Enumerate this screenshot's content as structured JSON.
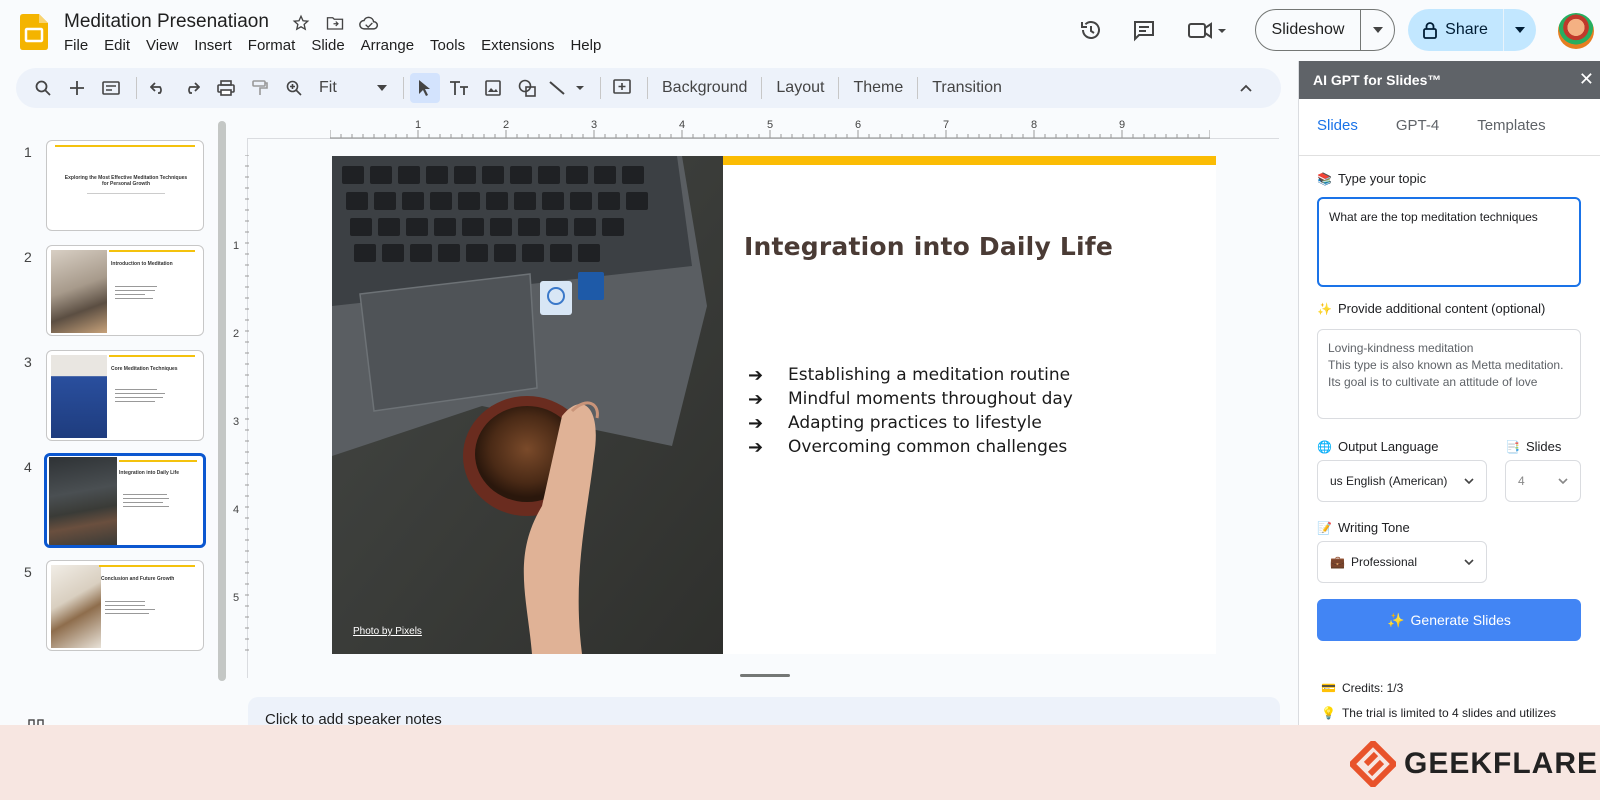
{
  "app": {
    "doc_title": "Meditation Presenatiaon",
    "menu": [
      "File",
      "Edit",
      "View",
      "Insert",
      "Format",
      "Slide",
      "Arrange",
      "Tools",
      "Extensions",
      "Help"
    ],
    "slideshow_label": "Slideshow",
    "share_label": "Share"
  },
  "toolbar": {
    "zoom": "Fit",
    "background": "Background",
    "layout": "Layout",
    "theme": "Theme",
    "transition": "Transition"
  },
  "filmstrip": {
    "slides": [
      {
        "num": "1",
        "title": "Exploring the Most Effective Meditation Techniques for Personal Growth"
      },
      {
        "num": "2",
        "title": "Introduction to Meditation"
      },
      {
        "num": "3",
        "title": "Core Meditation Techniques"
      },
      {
        "num": "4",
        "title": "Integration into Daily Life"
      },
      {
        "num": "5",
        "title": "Conclusion and Future Growth"
      }
    ]
  },
  "rulers": {
    "h": [
      "1",
      "2",
      "3",
      "4",
      "5",
      "6",
      "7",
      "8",
      "9"
    ],
    "v": [
      "1",
      "2",
      "3",
      "4",
      "5"
    ]
  },
  "slide": {
    "title": "Integration into Daily Life",
    "bullets": [
      "Establishing a meditation routine",
      "Mindful moments throughout day",
      "Adapting practices to lifestyle",
      "Overcoming common challenges"
    ],
    "photo_credit": "Photo by Pixels",
    "accent_color": "#fbbc04"
  },
  "notes": {
    "placeholder": "Click to add speaker notes"
  },
  "panel": {
    "title": "AI GPT for Slides™",
    "tabs": [
      "Slides",
      "GPT-4",
      "Templates"
    ],
    "topic_label": "Type your topic",
    "topic_value": "What are the top meditation techniques",
    "extra_label": "Provide additional content (optional)",
    "extra_value": "Loving-kindness meditation\nThis type is also known as Metta meditation.\nIts goal is to cultivate an attitude of love",
    "language_label": "Output Language",
    "language_value": "us English (American)",
    "slides_label": "Slides",
    "slides_value": "4",
    "tone_label": "Writing Tone",
    "tone_value": "Professional",
    "generate_label": "Generate Slides",
    "credits": "Credits: 1/3",
    "trial_note": "The trial is limited to 4 slides and utilizes"
  },
  "watermark": {
    "brand": "GEEKFLARE"
  }
}
